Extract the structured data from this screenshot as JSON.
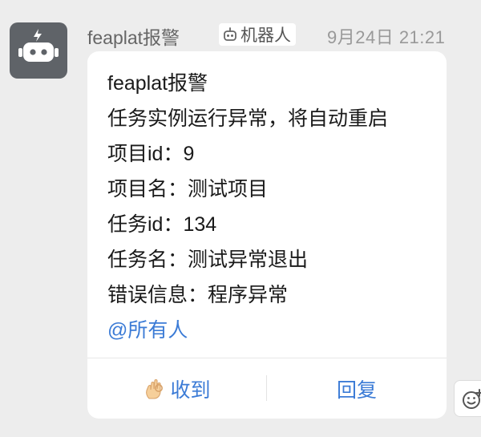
{
  "message": {
    "sender_name": "feaplat报警",
    "bot_tag_label": "机器人",
    "timestamp": "9月24日 21:21",
    "avatar_icon": "robot-icon",
    "body_lines": [
      "feaplat报警",
      "任务实例运行异常，将自动重启",
      "项目id：9",
      "项目名：测试项目",
      "任务id：134",
      "任务名：测试异常退出",
      "错误信息：程序异常"
    ],
    "mention": "@所有人",
    "actions": {
      "received_label": "收到",
      "received_icon": "ok-hand-icon",
      "reply_label": "回复"
    }
  },
  "colors": {
    "background": "#ededed",
    "card": "#ffffff",
    "link_blue": "#3b7bd6",
    "avatar_bg": "#5f6368"
  },
  "side_controls": {
    "emoji_reaction_icon": "emoji-add-icon"
  }
}
